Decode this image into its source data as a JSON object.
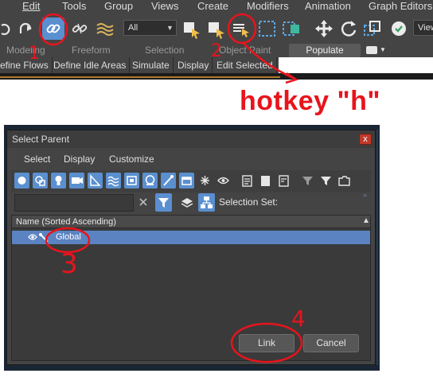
{
  "menubar": {
    "items": [
      "Edit",
      "Tools",
      "Group",
      "Views",
      "Create",
      "Modifiers",
      "Animation",
      "Graph Editors"
    ]
  },
  "toolbar": {
    "selection_filter": "All",
    "view_label": "View"
  },
  "ribbon": {
    "tabs": [
      "Modeling",
      "Freeform",
      "Selection",
      "Object Paint"
    ],
    "active_tab": "Populate",
    "subtabs": [
      "efine Flows",
      "Define Idle Areas",
      "Simulate",
      "Display",
      "Edit Selected"
    ]
  },
  "annotations": {
    "hotkey": "hotkey \"h\"",
    "step1": "1",
    "step2": "2",
    "step3": "3",
    "step4": "4"
  },
  "dialog": {
    "title": "Select Parent",
    "close_glyph": "x",
    "menu": [
      "Select",
      "Display",
      "Customize"
    ],
    "selection_set_label": "Selection Set:",
    "list_header": "Name (Sorted Ascending)",
    "sort_glyph": "▲",
    "rows": [
      "Global"
    ],
    "link_label": "Link",
    "cancel_label": "Cancel"
  },
  "colors": {
    "annotation_red": "#e8141c",
    "selection_blue": "#5b83c1",
    "filter_active": "#5a8fd0",
    "panel_bg": "#444444"
  }
}
